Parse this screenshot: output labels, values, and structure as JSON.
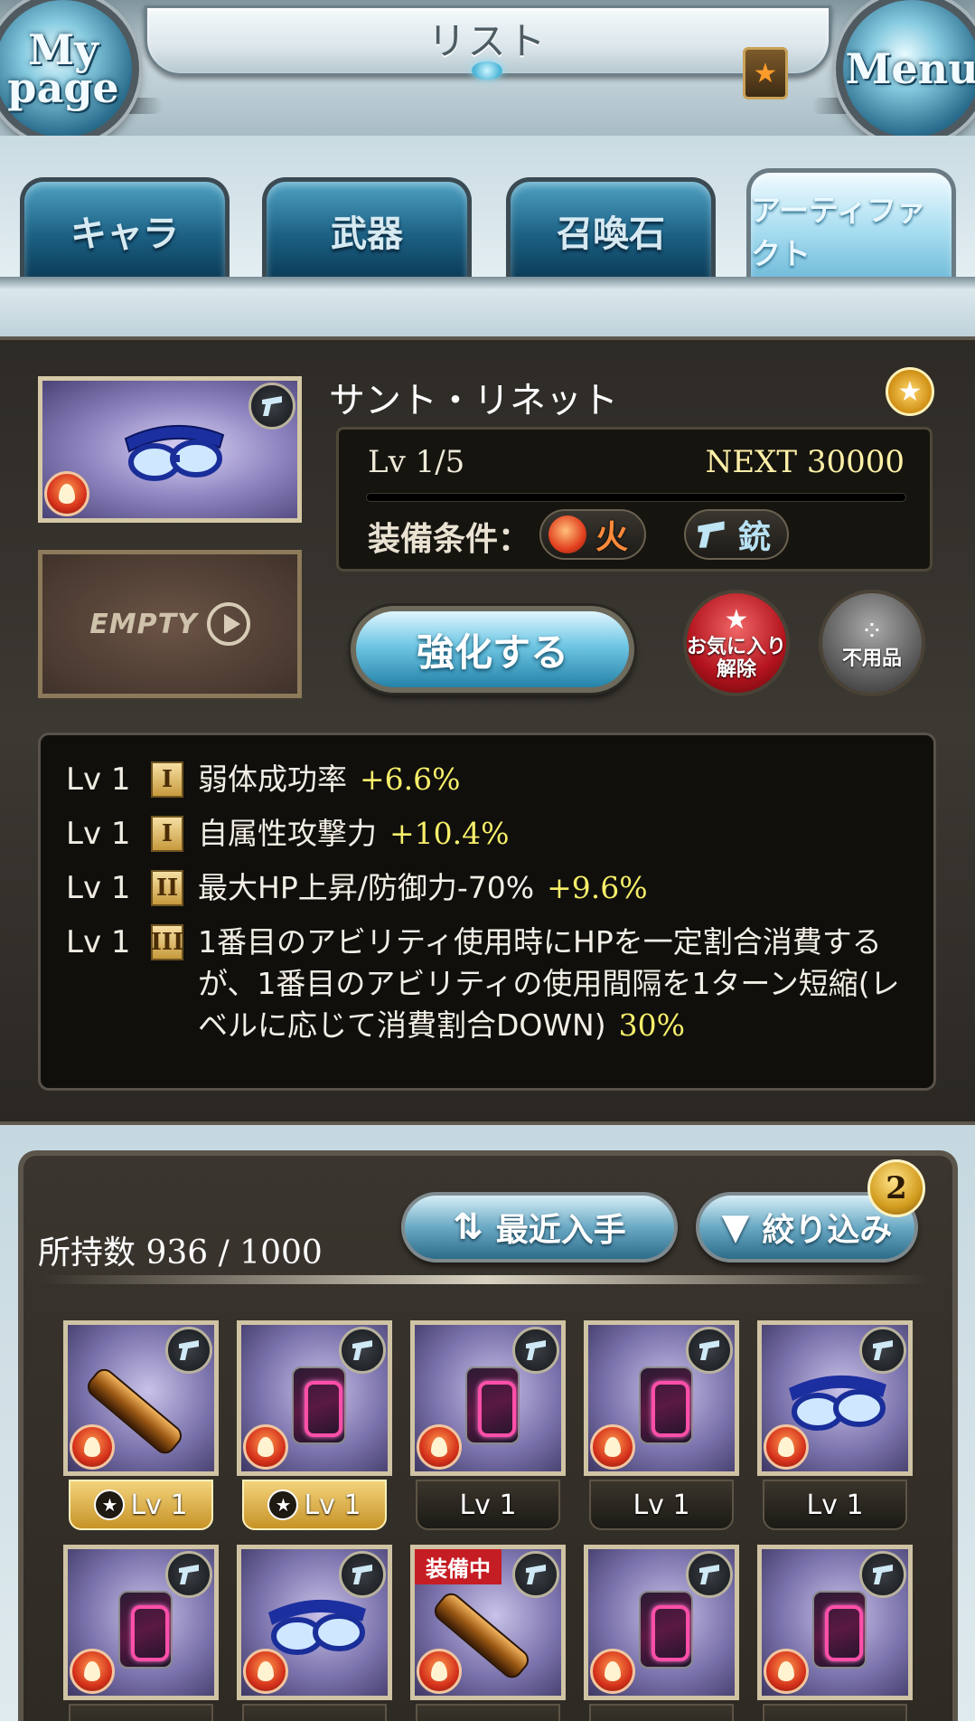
{
  "header": {
    "title": "リスト",
    "left_button": "My\npage",
    "right_button": "Menu",
    "favorite_icon": "star-icon"
  },
  "tabs": [
    {
      "label": "キャラ",
      "active": false
    },
    {
      "label": "武器",
      "active": false
    },
    {
      "label": "召喚石",
      "active": false
    },
    {
      "label": "アーティファクト",
      "active": true
    }
  ],
  "detail": {
    "name": "サント・リネット",
    "level": "Lv 1/5",
    "next": "NEXT 30000",
    "condition_label": "装備条件：",
    "condition_element": "火",
    "condition_weapon": "銃",
    "empty_slot": "EMPTY",
    "enhance_button": "強化する",
    "favorite_button": "お気に入り\n解除",
    "unused_button": "不用品",
    "colors": {
      "accent": "#6fc7e4",
      "value": "#f7ef6a",
      "fire": "#e2401f",
      "gold": "#d39d1f"
    }
  },
  "skills": [
    {
      "lv": "Lv 1",
      "tier": "I",
      "text": "弱体成功率",
      "value": "+6.6%"
    },
    {
      "lv": "Lv 1",
      "tier": "I",
      "text": "自属性攻撃力",
      "value": "+10.4%"
    },
    {
      "lv": "Lv 1",
      "tier": "II",
      "text": "最大HP上昇/防御力-70%",
      "value": "+9.6%"
    },
    {
      "lv": "Lv 1",
      "tier": "III",
      "text": "1番目のアビリティ使用時にHPを一定割合消費するが、1番目のアビリティの使用間隔を1ターン短縮(レベルに応じて消費割合DOWN)",
      "value": "30%"
    }
  ],
  "list": {
    "owned": "所持数 936 / 1000",
    "sort_button": "最近入手",
    "filter_button": "絞り込み",
    "filter_count": "2",
    "items": [
      {
        "kind": "scope",
        "level": "Lv 1",
        "favorite": true,
        "equipped": false
      },
      {
        "kind": "tag",
        "level": "Lv 1",
        "favorite": true,
        "equipped": false
      },
      {
        "kind": "tag",
        "level": "Lv 1",
        "favorite": false,
        "equipped": false
      },
      {
        "kind": "tag",
        "level": "Lv 1",
        "favorite": false,
        "equipped": false
      },
      {
        "kind": "goggles",
        "level": "Lv 1",
        "favorite": false,
        "equipped": false
      },
      {
        "kind": "tag",
        "level": "",
        "favorite": false,
        "equipped": false
      },
      {
        "kind": "goggles",
        "level": "",
        "favorite": false,
        "equipped": false
      },
      {
        "kind": "scope",
        "level": "",
        "favorite": false,
        "equipped": true,
        "equipped_label": "装備中"
      },
      {
        "kind": "tag",
        "level": "",
        "favorite": false,
        "equipped": false
      },
      {
        "kind": "tag",
        "level": "",
        "favorite": false,
        "equipped": false
      }
    ]
  }
}
